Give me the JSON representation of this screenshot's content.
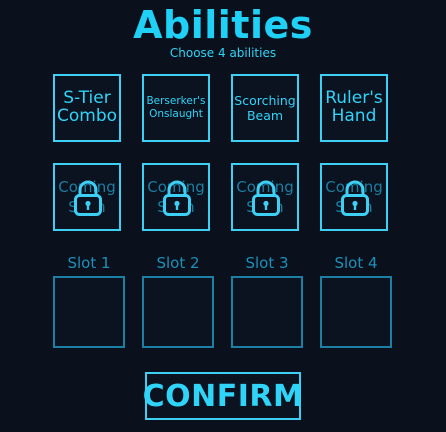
{
  "title": "Abilities",
  "subtitle": "Choose 4 abilities",
  "abilities": [
    {
      "label": "S-Tier Combo"
    },
    {
      "label": "Berserker's Onslaught"
    },
    {
      "label": "Scorching Beam"
    },
    {
      "label": "Ruler's Hand"
    }
  ],
  "locked": [
    {
      "label": "Coming Soon",
      "icon": "lock-icon"
    },
    {
      "label": "Coming Soon",
      "icon": "lock-icon"
    },
    {
      "label": "Coming Soon",
      "icon": "lock-icon"
    },
    {
      "label": "Coming Soon",
      "icon": "lock-icon"
    }
  ],
  "slots": [
    {
      "label": "Slot 1"
    },
    {
      "label": "Slot 2"
    },
    {
      "label": "Slot 3"
    },
    {
      "label": "Slot 4"
    }
  ],
  "confirm_label": "CONFIRM",
  "colors": {
    "accent": "#3ecff4",
    "background": "#0a111c",
    "muted": "#1e7fa4"
  }
}
